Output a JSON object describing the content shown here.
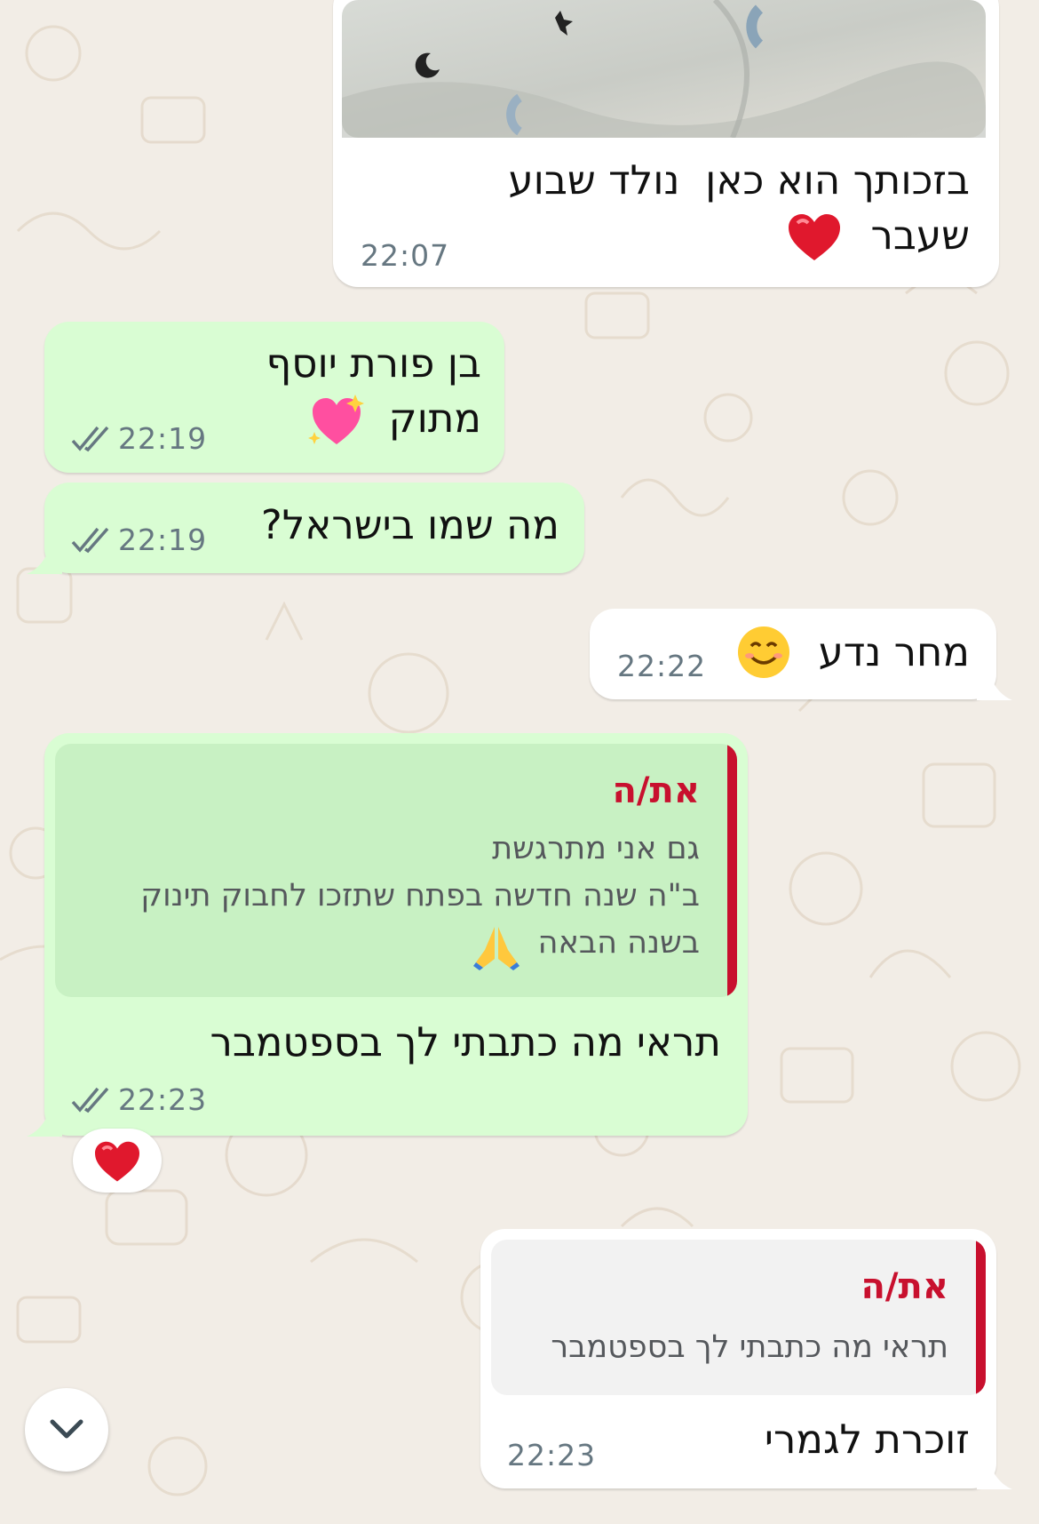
{
  "messages": [
    {
      "text": "בזכותך הוא כאן  נולד שבוע שעבר",
      "time": "22:07"
    },
    {
      "text": "בן פורת יוסף\nמתוק",
      "time": "22:19"
    },
    {
      "text": "מה שמו בישראל?",
      "time": "22:19"
    },
    {
      "text": "מחר נדע",
      "time": "22:22"
    },
    {
      "quote": {
        "name": "את/ה",
        "text": "גם אני מתרגשת\nב\"ה שנה חדשה בפתח שתזכו לחבוק תינוק\nבשנה הבאה"
      },
      "text": "תראי מה כתבתי לך בספטמבר",
      "time": "22:23",
      "reaction": "heart"
    },
    {
      "quote": {
        "name": "את/ה",
        "text": "תראי מה כתבתי לך בספטמבר"
      },
      "text": "זוכרת לגמרי",
      "time": "22:23"
    }
  ],
  "icons": {
    "scroll_down": "chevron-down-icon",
    "read_receipt": "double-check-icon"
  },
  "colors": {
    "incoming_bubble": "#ffffff",
    "outgoing_bubble": "#d9fdd3",
    "quote_bar": "#c8102e",
    "chat_background": "#f2ede6"
  }
}
